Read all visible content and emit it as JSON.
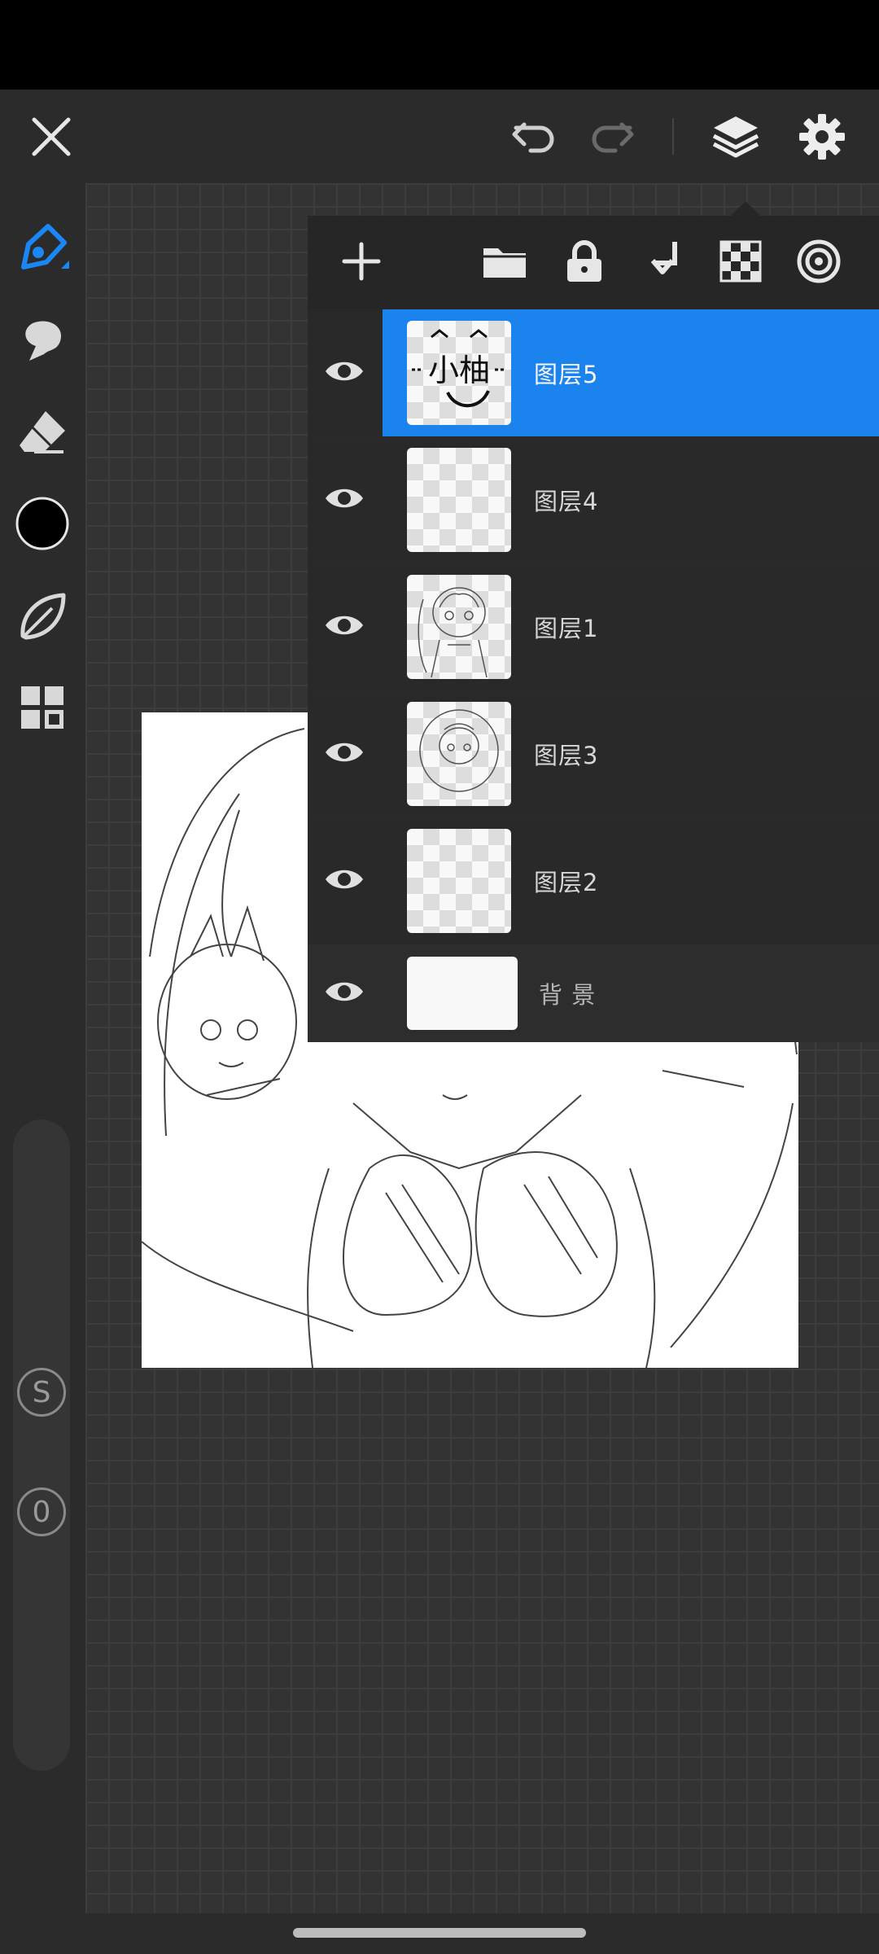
{
  "top_bar": {
    "close_icon": "close-icon",
    "undo_icon": "undo-icon",
    "redo_icon": "redo-icon",
    "layers_icon": "layers-icon",
    "settings_icon": "settings-icon"
  },
  "left_toolbar": {
    "tools": [
      {
        "name": "pen-tool",
        "icon": "pen-icon",
        "active": true
      },
      {
        "name": "smudge-tool",
        "icon": "smudge-icon"
      },
      {
        "name": "eraser-tool",
        "icon": "eraser-icon"
      },
      {
        "name": "color-swatch",
        "icon": "color-circle",
        "color": "#000000"
      },
      {
        "name": "leaf-tool",
        "icon": "leaf-icon"
      },
      {
        "name": "gallery-tool",
        "icon": "grid-icon"
      }
    ],
    "size_label": "S",
    "opacity_label": "0"
  },
  "layers_panel": {
    "toolbar_icons": [
      "add-icon",
      "folder-icon",
      "lock-icon",
      "merge-down-icon",
      "transparency-icon",
      "blend-icon"
    ],
    "layers": [
      {
        "name": "图层5",
        "selected": true,
        "visible": true
      },
      {
        "name": "图层4",
        "selected": false,
        "visible": true
      },
      {
        "name": "图层1",
        "selected": false,
        "visible": true
      },
      {
        "name": "图层3",
        "selected": false,
        "visible": true
      },
      {
        "name": "图层2",
        "selected": false,
        "visible": true
      },
      {
        "name": "背 景",
        "selected": false,
        "visible": true
      }
    ],
    "thumbnail_text": "小柚"
  },
  "colors": {
    "accent": "#1a87f5",
    "background": "#2b2b2b",
    "panel": "#262626"
  }
}
